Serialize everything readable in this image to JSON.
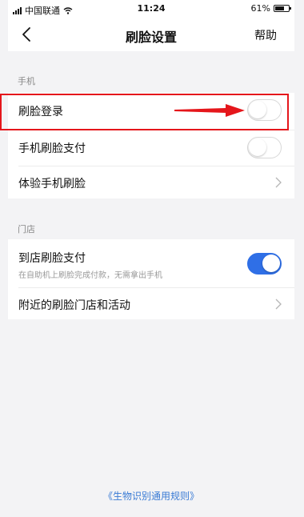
{
  "status_bar": {
    "carrier": "中国联通",
    "time": "11:24",
    "battery": "61%",
    "icons": [
      "signal-icon",
      "wifi-icon",
      "battery-icon"
    ]
  },
  "nav": {
    "back_icon": "chevron-left-icon",
    "title": "刷脸设置",
    "help": "帮助"
  },
  "phone_section": {
    "header": "手机",
    "rows": [
      {
        "label": "刷脸登录",
        "control": "toggle",
        "state": "off"
      },
      {
        "label": "手机刷脸支付",
        "control": "toggle",
        "state": "off"
      },
      {
        "label": "体验手机刷脸",
        "control": "chevron-right-icon"
      }
    ]
  },
  "store_section": {
    "header": "门店",
    "rows": [
      {
        "label": "到店刷脸支付",
        "sublabel": "在自助机上刷脸完成付款，无需拿出手机",
        "control": "toggle",
        "state": "on"
      },
      {
        "label": "附近的刷脸门店和活动",
        "control": "chevron-right-icon"
      }
    ]
  },
  "footer": {
    "link": "《生物识别通用规则》"
  },
  "colors": {
    "accent": "#2f6fe6",
    "annotation": "#e5161b",
    "background": "#f3f3f5",
    "link": "#3a7bd5"
  }
}
